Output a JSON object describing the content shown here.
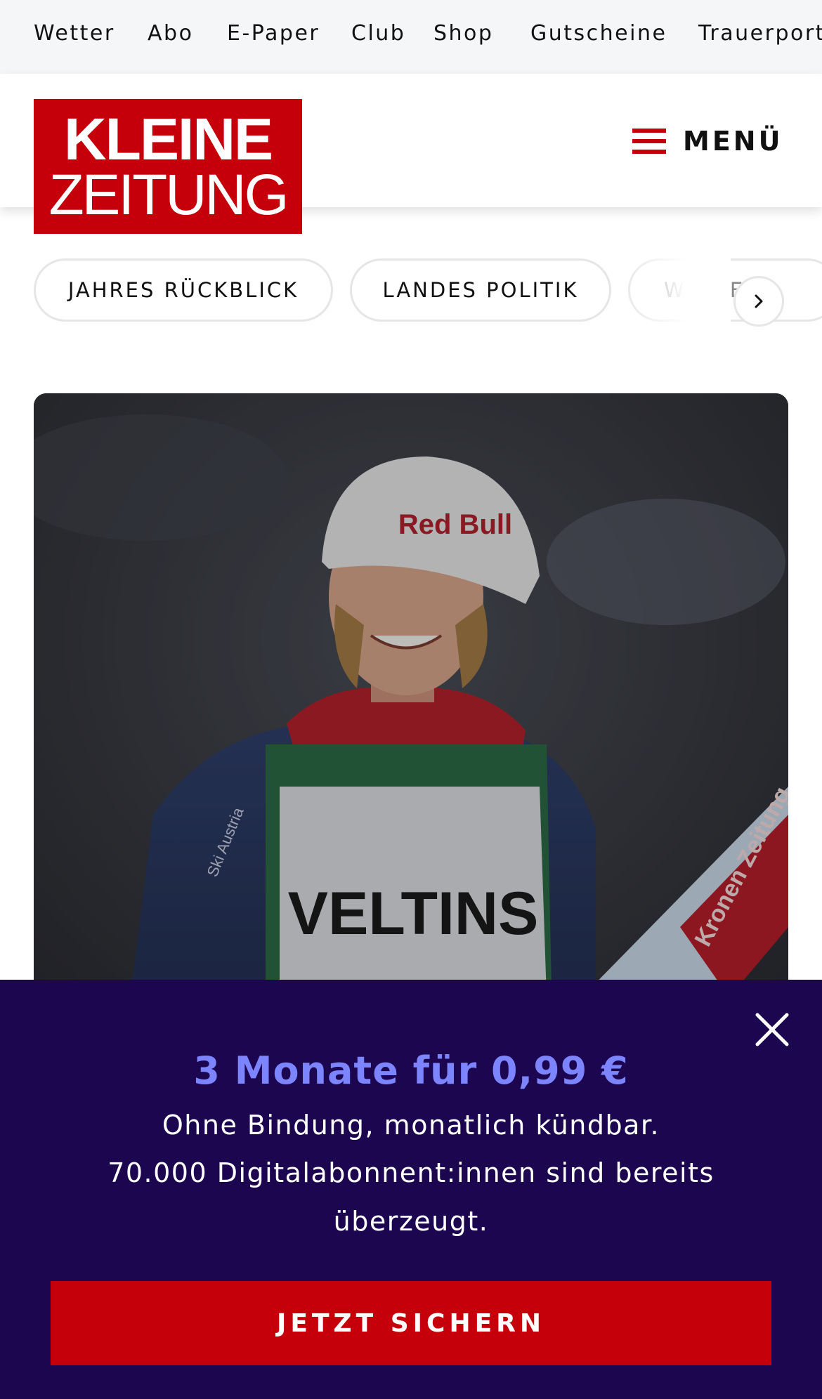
{
  "topnav": {
    "items": [
      "Wetter",
      "Abo",
      "E-Paper",
      "Club",
      "Shop",
      "Gutscheine",
      "Trauerportal"
    ]
  },
  "header": {
    "logo_line1": "KLEINE",
    "logo_line2": "ZEITUNG",
    "menu_label": "MENÜ"
  },
  "chips": {
    "items": [
      "JAHRES RÜCKBLICK",
      "LANDES POLITIK",
      "WETTER"
    ]
  },
  "hero": {
    "image_texts": [
      "Red Bull",
      "VELTINS",
      "Ski Austria",
      "Kronen Zeitung"
    ]
  },
  "offer": {
    "title": "3 Monate für 0,99 €",
    "line1": "Ohne Bindung, monatlich kündbar.",
    "line2": "70.000 Digitalabonnent:innen sind bereits",
    "line3": "überzeugt.",
    "cta_label": "JETZT SICHERN"
  },
  "colors": {
    "brand_red": "#c6000b",
    "banner_bg": "#1c0650",
    "offer_accent": "#7c84ff"
  },
  "icons": [
    "hamburger-icon",
    "chevron-right-icon",
    "close-icon"
  ]
}
